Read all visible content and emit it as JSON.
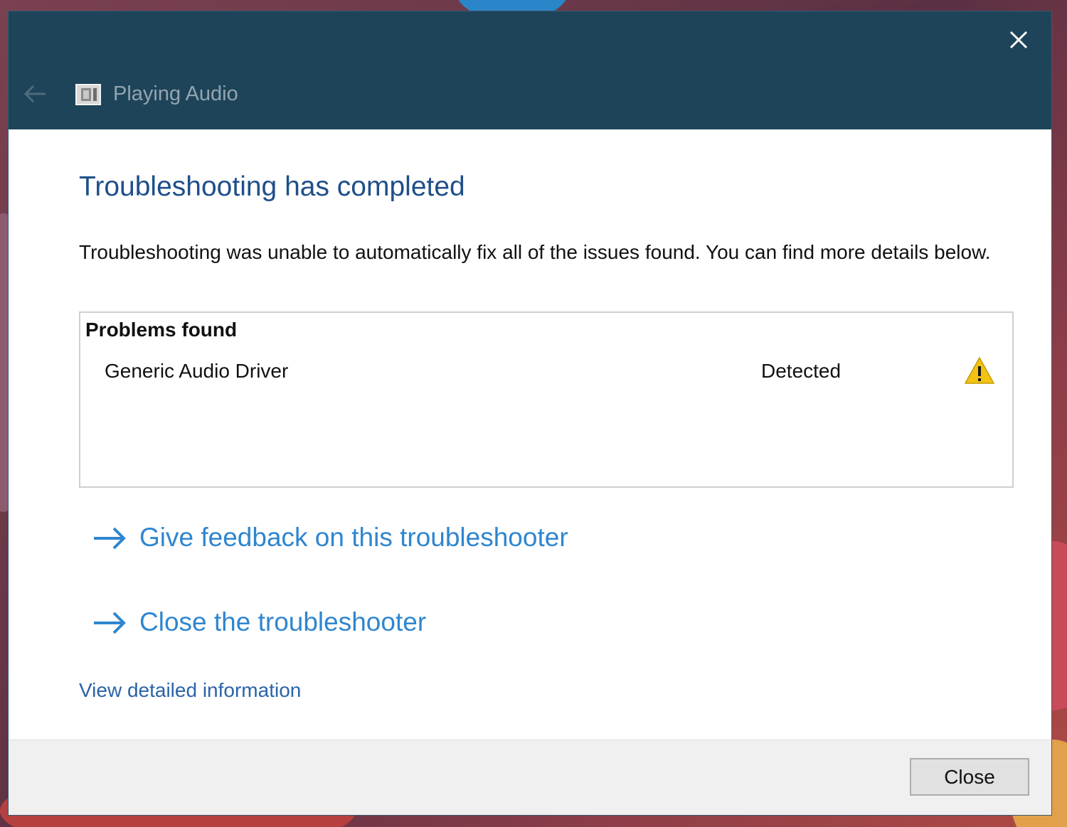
{
  "window": {
    "title": "Playing Audio",
    "close_icon": "close-icon",
    "back_icon": "back-arrow-icon",
    "app_icon": "troubleshooter-icon"
  },
  "main": {
    "heading": "Troubleshooting has completed",
    "description": "Troubleshooting was unable to automatically fix all of the issues found. You can find more details below.",
    "problems": {
      "header": "Problems found",
      "items": [
        {
          "name": "Generic Audio Driver",
          "status": "Detected",
          "status_icon": "warning-icon"
        }
      ]
    },
    "actions": [
      {
        "label": "Give feedback on this troubleshooter",
        "icon": "arrow-right-icon"
      },
      {
        "label": "Close the troubleshooter",
        "icon": "arrow-right-icon"
      }
    ],
    "details_link": "View detailed information"
  },
  "footer": {
    "close_label": "Close"
  },
  "colors": {
    "titlebar": "#1e4459",
    "heading": "#1f4f8a",
    "link": "#2f86cf",
    "warning": "#f2c314"
  }
}
